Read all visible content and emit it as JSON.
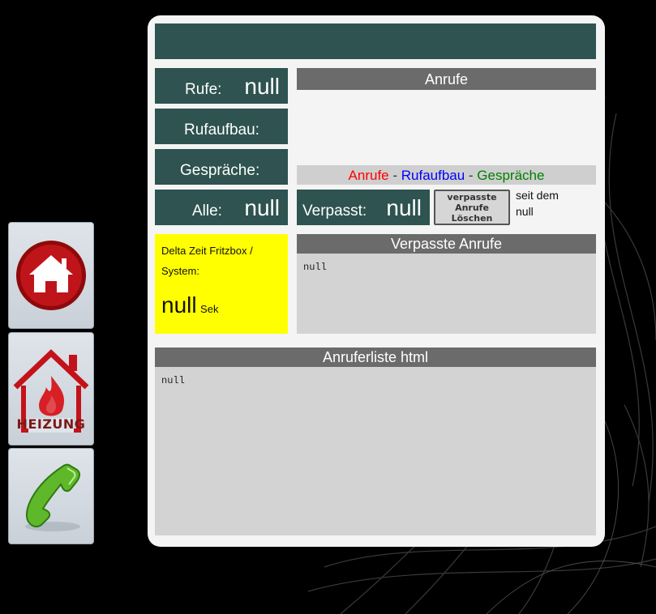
{
  "nav": {
    "home_icon": "home-icon",
    "heating_label": "HEIZUNG",
    "phone_icon": "phone-icon"
  },
  "stats": {
    "rufe_label": "Rufe:",
    "rufe_value": "null",
    "rufaufbau_label": "Rufaufbau:",
    "gespraeche_label": "Gespräche:",
    "alle_label": "Alle:",
    "alle_value": "null"
  },
  "delta": {
    "label": "Delta Zeit Fritzbox / System:",
    "value": "null",
    "unit": "Sek"
  },
  "anrufe": {
    "title": "Anrufe",
    "legend_anrufe": "Anrufe",
    "legend_sep1": " - ",
    "legend_rufaufbau": "Rufaufbau",
    "legend_sep2": " - ",
    "legend_gespraeche": "Gespräche"
  },
  "verpasst": {
    "label": "Verpasst:",
    "value": "null",
    "button_label": "verpasste Anrufe Löschen",
    "since_label": "seit dem",
    "since_value": "null"
  },
  "missed_calls": {
    "title": "Verpasste Anrufe",
    "content": "null"
  },
  "caller_list": {
    "title": "Anruferliste html",
    "content": "null"
  },
  "colors": {
    "legend_anrufe": "#ff0000",
    "legend_rufaufbau": "#0000ff",
    "legend_gespraeche": "#008000",
    "tile": "#2e5350",
    "delta_bg": "#ffff00"
  }
}
